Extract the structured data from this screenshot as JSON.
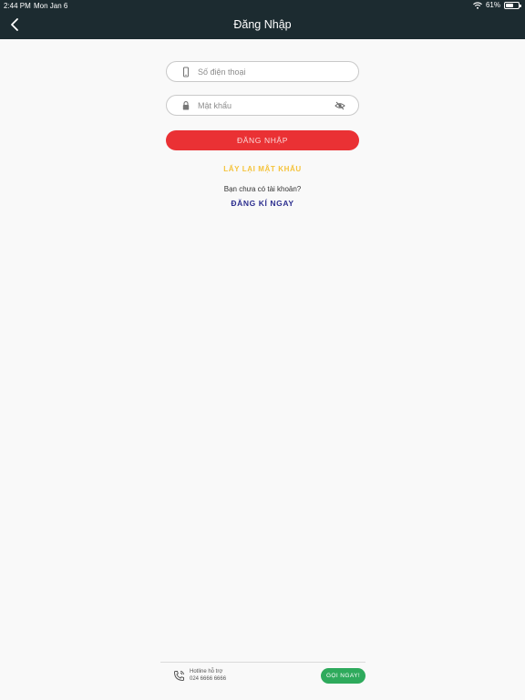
{
  "status_bar": {
    "time": "2:44 PM",
    "date": "Mon Jan 6",
    "battery_text": "61%",
    "battery_level": 0.61
  },
  "header": {
    "title": "Đăng Nhập",
    "back_icon": "chevron-left-icon"
  },
  "form": {
    "phone_placeholder": "Số điện thoại",
    "password_placeholder": "Mật khẩu",
    "login_label": "ĐĂNG NHẬP",
    "forgot_label": "LẤY LẠI MẬT KHẨU",
    "no_account_text": "Bạn chưa có tài khoản?",
    "register_label": "ĐĂNG KÍ NGAY"
  },
  "footer": {
    "hotline_label": "Hotline hỗ trợ",
    "hotline_number": "024 6666 6666",
    "call_label": "GỌI NGAY!"
  },
  "colors": {
    "header_bg": "#1c2b30",
    "login_button": "#ea3134",
    "forgot_link": "#f5c33b",
    "register_link": "#2d2f8f",
    "call_button": "#2eaa5c"
  }
}
